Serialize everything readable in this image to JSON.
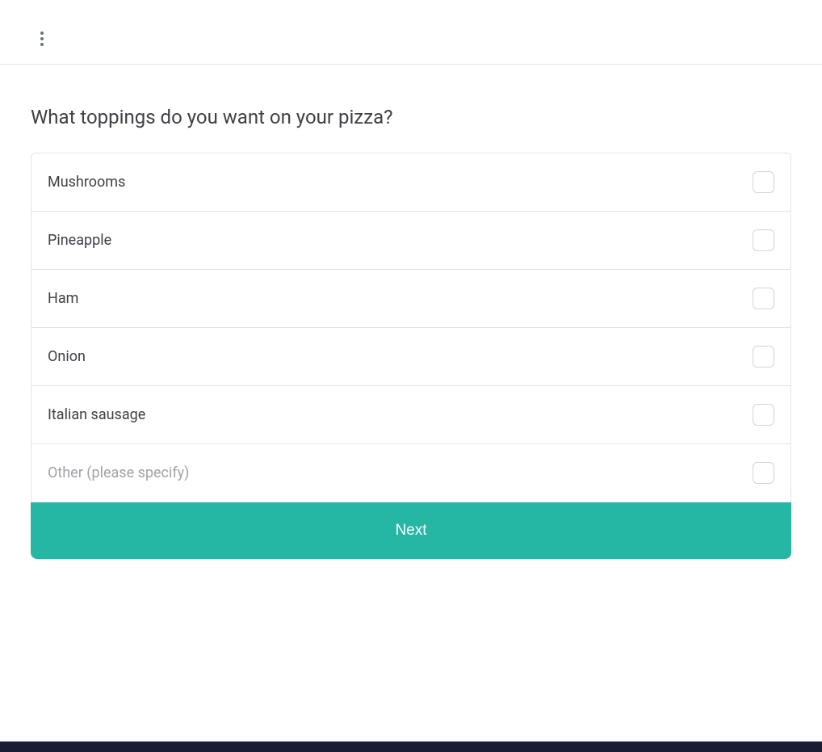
{
  "question": "What toppings do you want on your pizza?",
  "options": [
    {
      "label": "Mushrooms",
      "muted": false
    },
    {
      "label": "Pineapple",
      "muted": false
    },
    {
      "label": "Ham",
      "muted": false
    },
    {
      "label": "Onion",
      "muted": false
    },
    {
      "label": "Italian sausage",
      "muted": false
    },
    {
      "label": "Other (please specify)",
      "muted": true
    }
  ],
  "next_label": "Next"
}
